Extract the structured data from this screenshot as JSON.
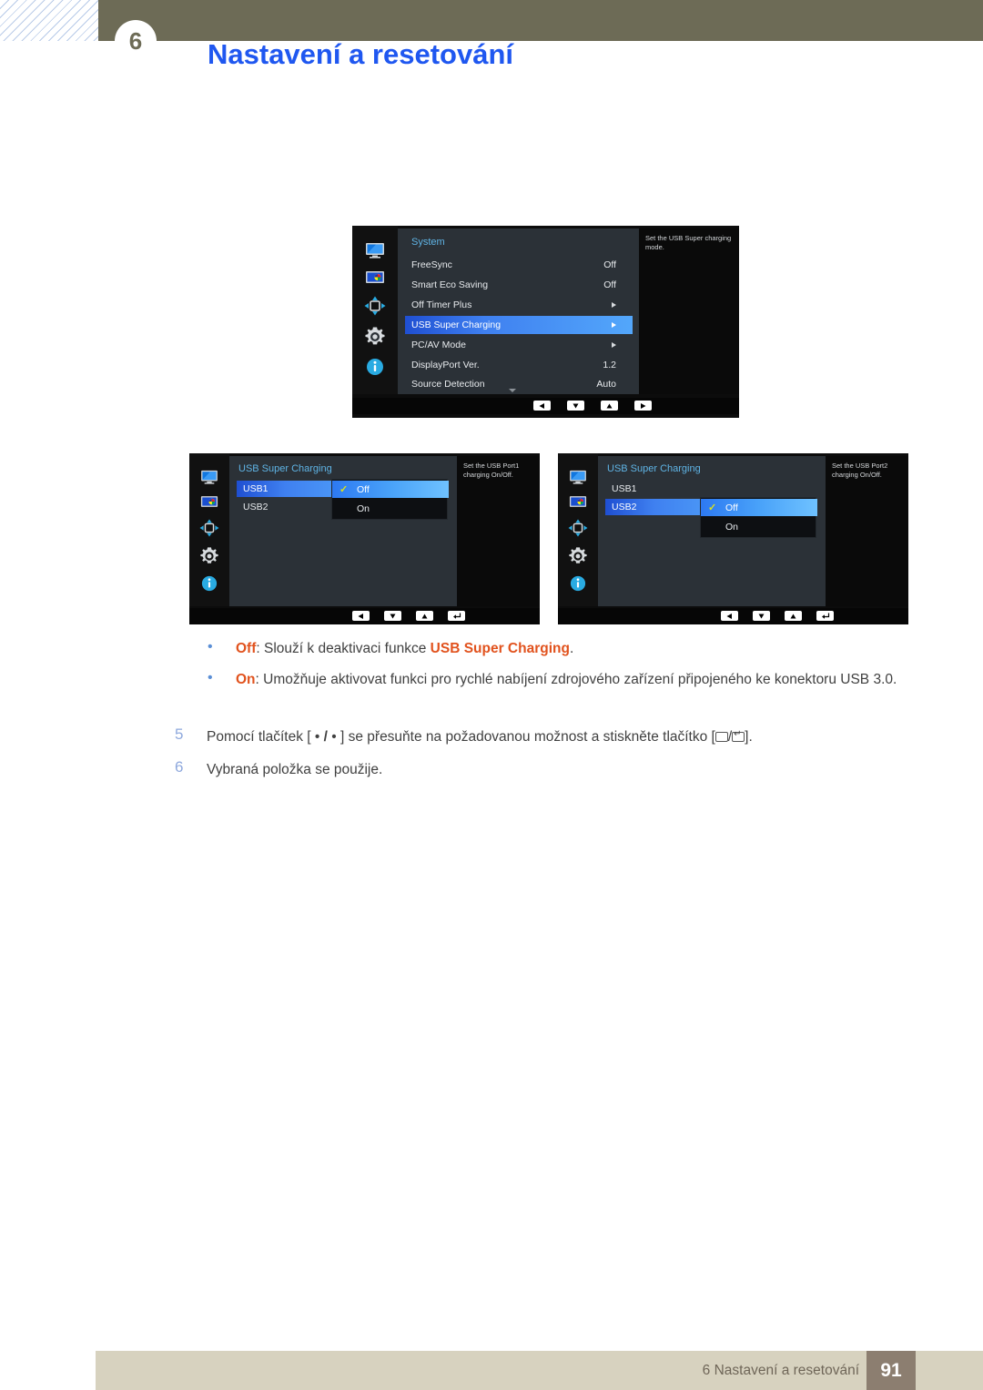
{
  "header": {
    "chapter_badge": "6",
    "title": "Nastavení a resetování"
  },
  "osd_main": {
    "title": "System",
    "help": "Set the USB Super charging mode.",
    "sidebar_icons": [
      "display-icon",
      "picture-icon",
      "onscreen-display-icon",
      "system-gear-icon",
      "information-icon"
    ],
    "rows": [
      {
        "label": "FreeSync",
        "value": "Off",
        "type": "value",
        "selected": false
      },
      {
        "label": "Smart Eco Saving",
        "value": "Off",
        "type": "value",
        "selected": false
      },
      {
        "label": "Off Timer Plus",
        "value": "",
        "type": "submenu",
        "selected": false
      },
      {
        "label": "USB Super Charging",
        "value": "",
        "type": "submenu",
        "selected": true
      },
      {
        "label": "PC/AV Mode",
        "value": "",
        "type": "submenu",
        "selected": false
      },
      {
        "label": "DisplayPort Ver.",
        "value": "1.2",
        "type": "value",
        "selected": false
      },
      {
        "label": "Source Detection",
        "value": "Auto",
        "type": "value",
        "selected": false
      }
    ],
    "nav_buttons": [
      "left-arrow-icon",
      "down-arrow-icon",
      "up-arrow-icon",
      "right-arrow-icon"
    ]
  },
  "osd_usb1": {
    "title": "USB Super Charging",
    "help": "Set the USB Port1 charging On/Off.",
    "rows": [
      {
        "label": "USB1",
        "selected": true
      },
      {
        "label": "USB2",
        "selected": false
      }
    ],
    "popup": {
      "options": [
        {
          "label": "Off",
          "checked": true,
          "selected": true
        },
        {
          "label": "On",
          "checked": false,
          "selected": false
        }
      ]
    },
    "nav_buttons": [
      "left-arrow-icon",
      "down-arrow-icon",
      "up-arrow-icon",
      "enter-icon"
    ]
  },
  "osd_usb2": {
    "title": "USB Super Charging",
    "help": "Set the USB Port2 charging On/Off.",
    "rows": [
      {
        "label": "USB1",
        "selected": false
      },
      {
        "label": "USB2",
        "selected": true
      }
    ],
    "popup": {
      "options": [
        {
          "label": "Off",
          "checked": true,
          "selected": true
        },
        {
          "label": "On",
          "checked": false,
          "selected": false
        }
      ]
    },
    "nav_buttons": [
      "left-arrow-icon",
      "down-arrow-icon",
      "up-arrow-icon",
      "enter-icon"
    ]
  },
  "body": {
    "bullet_off_kw": "Off",
    "bullet_off_mid": ": Slouží k deaktivaci funkce ",
    "bullet_off_kw2": "USB Super Charging",
    "bullet_off_end": ".",
    "bullet_on_kw": "On",
    "bullet_on_text": ": Umožňuje aktivovat funkci pro rychlé nabíjení zdrojového zařízení připojeného ke konektoru USB 3.0.",
    "step5_num": "5",
    "step5_a": "Pomocí tlačítek [ ",
    "step5_dot1": "•",
    "step5_slash": " / ",
    "step5_dot2": "•",
    "step5_b": " ] se přesuňte na požadovanou možnost a stiskněte tlačítko [",
    "step5_sep": "/",
    "step5_c": "].",
    "step6_num": "6",
    "step6_text": "Vybraná položka se použije."
  },
  "footer": {
    "text": "6 Nastavení a resetování",
    "page": "91"
  },
  "colors": {
    "header_bar": "#6d6b56",
    "title_blue": "#1f57f0",
    "keyword_orange": "#e1521d",
    "footer_bar": "#d7d2bf",
    "page_box": "#8c7e70",
    "osd_title_blue": "#5fb4e5",
    "osd_highlight": "#3f80f0"
  }
}
